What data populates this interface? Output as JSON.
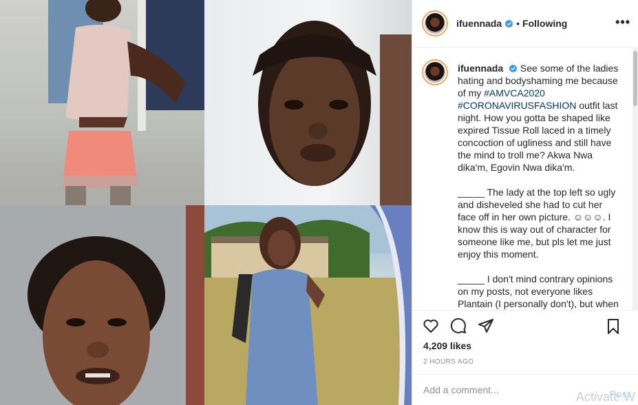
{
  "photos": [
    {
      "id": "photo-top-left"
    },
    {
      "id": "photo-top-right"
    },
    {
      "id": "photo-bottom-left"
    },
    {
      "id": "photo-bottom-right"
    }
  ],
  "header": {
    "username": "ifuennada",
    "separator": "•",
    "follow_status": "Following",
    "more_label": "•••"
  },
  "caption": {
    "username": "ifuennada",
    "p1_a": "See some of the ladies hating and bodyshaming me because of my ",
    "tag1": "#AMVCA2020",
    "p1_b": " ",
    "tag2": "#CORONAVIRUSFASHION",
    "p1_c": " outfit last night. How you gotta be shaped like expired Tissue Roll laced in a timely concoction of ugliness and still have the mind to troll me? Akwa Nwa dika'm, Egovin Nwa dika'm.",
    "p2": "_____ The lady at the top left so ugly and disheveled she had to cut her face off in her own picture. ☺☺☺. I know this is way out of character for someone like me, but pls let me just enjoy this moment.",
    "p3": "_____ I don't mind contrary opinions on my posts, not everyone likes Plantain (I personally don't), but when you now"
  },
  "likes": "4,209 likes",
  "timestamp": "2 HOURS AGO",
  "comment": {
    "placeholder": "Add a comment...",
    "post_label": "Post"
  },
  "watermark": "Activate W",
  "colors": {
    "accent_link": "#00376b",
    "verified": "#3897f0",
    "ring": "#f2a65a",
    "muted": "#8e8e8e"
  },
  "icons": [
    "heart-icon",
    "comment-icon",
    "share-icon",
    "bookmark-icon",
    "verified-icon",
    "more-icon"
  ]
}
